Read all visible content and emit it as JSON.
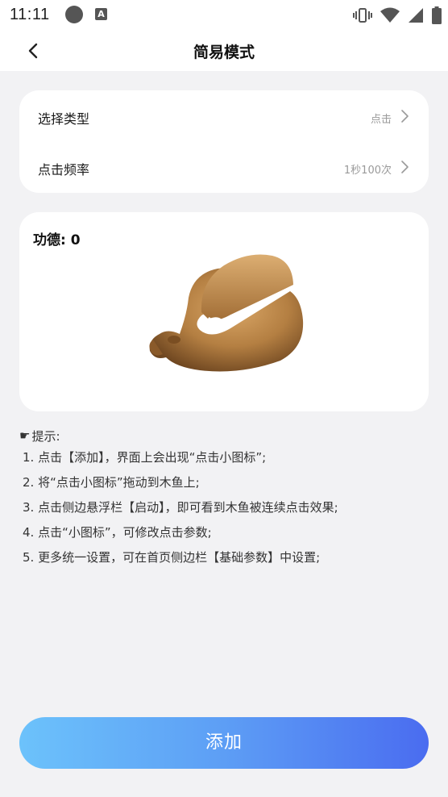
{
  "status_bar": {
    "time": "11:11",
    "icons": [
      "record-dot-icon",
      "a-notification-icon",
      "vibrate-icon",
      "wifi-icon",
      "signal-icon",
      "battery-icon"
    ]
  },
  "nav": {
    "title": "简易模式",
    "back_icon": "chevron-left-icon"
  },
  "settings": [
    {
      "label": "选择类型",
      "value": "点击"
    },
    {
      "label": "点击频率",
      "value": "1秒100次"
    }
  ],
  "fish_card": {
    "merit_label": "功德: 0",
    "image": "wooden-fish-image"
  },
  "tips": {
    "title": "提示:",
    "lines": [
      "1. 点击【添加】，界面上会出现“点击小图标”;",
      "2. 将“点击小图标”拖动到木鱼上;",
      "3. 点击侧边悬浮栏【启动】，即可看到木鱼被连续点击效果;",
      "4. 点击“小图标”，可修改点击参数;",
      "5. 更多统一设置，可在首页侧边栏【基础参数】中设置;"
    ]
  },
  "add_button": {
    "label": "添加"
  },
  "colors": {
    "background": "#f2f2f4",
    "card": "#ffffff",
    "button_gradient_start": "#6cc2fb",
    "button_gradient_end": "#4a6cf0"
  }
}
